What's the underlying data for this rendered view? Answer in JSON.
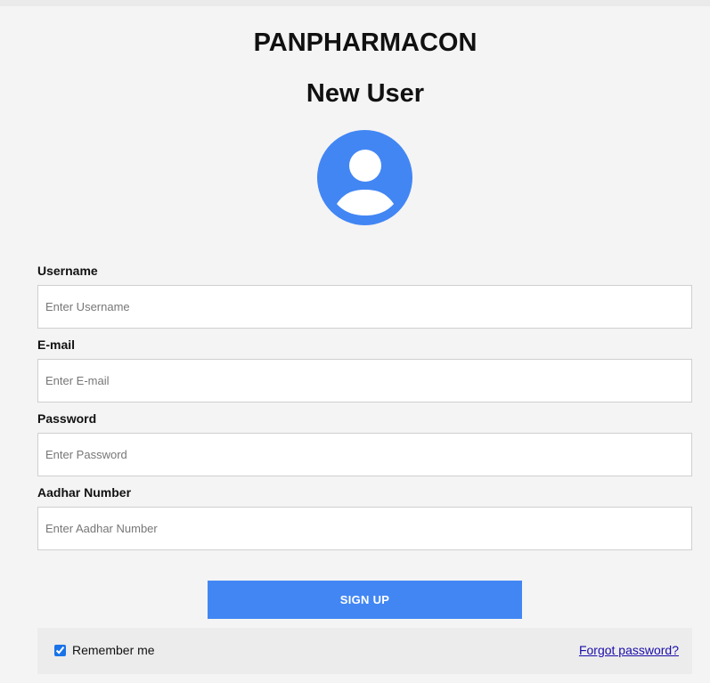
{
  "header": {
    "brand": "PANPHARMACON",
    "subtitle": "New User"
  },
  "avatar": {
    "icon": "user-avatar-icon",
    "color": "#4286f4"
  },
  "form": {
    "fields": [
      {
        "label": "Username",
        "placeholder": "Enter Username",
        "value": ""
      },
      {
        "label": "E-mail",
        "placeholder": "Enter E-mail",
        "value": ""
      },
      {
        "label": "Password",
        "placeholder": "Enter Password",
        "value": ""
      },
      {
        "label": "Aadhar Number",
        "placeholder": "Enter Aadhar Number",
        "value": ""
      }
    ],
    "submit_label": "SIGN UP"
  },
  "footer": {
    "remember_label": "Remember me",
    "remember_checked": true,
    "forgot_label": "Forgot password?"
  },
  "colors": {
    "accent": "#4286f4",
    "background": "#f4f4f4",
    "link": "#1a0dab"
  }
}
